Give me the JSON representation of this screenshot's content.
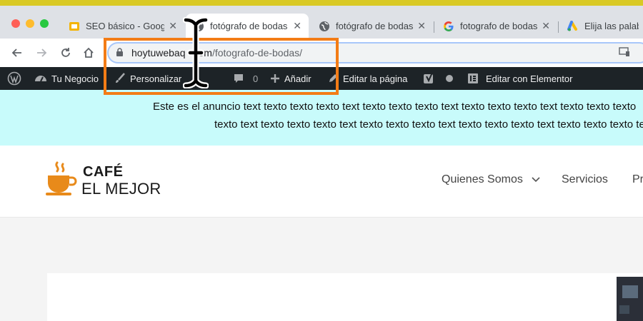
{
  "colors": {
    "announce_bg": "#c8fbfb",
    "admin_bar_bg": "#1d2327",
    "highlight_border": "#f37c16",
    "tab_bar_bg": "#dee1e6",
    "logo_cup": "#e88a1a"
  },
  "tabs": [
    {
      "title": "SEO básico - Goog",
      "icon": "google-slides-icon",
      "active": false
    },
    {
      "title": "fotógrafo de bodas",
      "icon": "globe-icon",
      "active": true
    },
    {
      "title": "fotógrafo de bodas",
      "icon": "globe-icon",
      "active": false
    },
    {
      "title": "fotografo de bodas",
      "icon": "google-g-icon",
      "active": false
    },
    {
      "title": "Elija las palabras",
      "icon": "google-ads-icon",
      "active": false
    }
  ],
  "toolbar": {
    "url_domain": "hoytuwebaq",
    "url_domain_tail": "om",
    "url_path": "/fotografo-de-bodas/"
  },
  "adminbar": {
    "site_name": "Tu Negocio",
    "customize": "Personalizar",
    "comments_count": "0",
    "add_new": "Añadir",
    "edit_page": "Editar la página",
    "elementor": "Editar con Elementor"
  },
  "announcement": {
    "line1": "Este es el anuncio text texto texto texto text texto texto texto text texto texto texto text texto texto texto",
    "line2": "texto text texto texto texto text texto texto texto text texto texto texto text texto texto texto text texto"
  },
  "site": {
    "logo_line1": "CAFÉ",
    "logo_line2": "EL MEJOR",
    "menu": [
      "Quienes Somos",
      "Servicios",
      "Pr"
    ]
  }
}
